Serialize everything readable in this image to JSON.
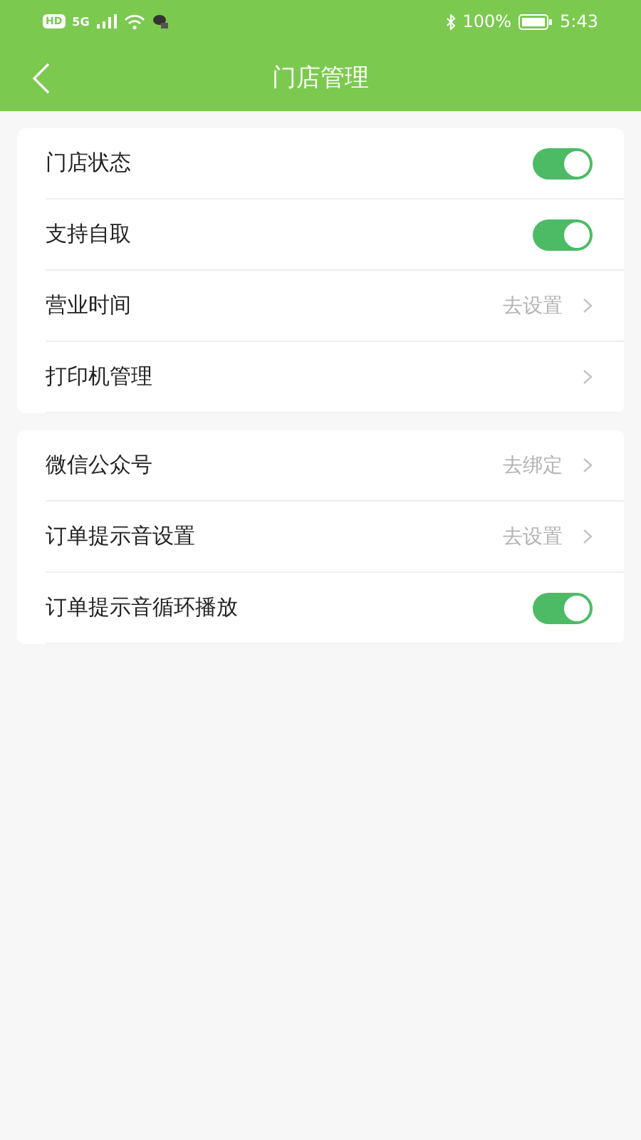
{
  "status_bar": {
    "left": [
      "HD",
      "5G"
    ],
    "battery": "100%",
    "time": "5:43"
  },
  "nav": {
    "title": "门店管理"
  },
  "groups": [
    {
      "items": [
        {
          "kind": "toggle",
          "label": "门店状态",
          "on": true
        },
        {
          "kind": "toggle",
          "label": "支持自取",
          "on": true
        },
        {
          "kind": "link",
          "label": "营业时间",
          "action": "去设置"
        },
        {
          "kind": "link",
          "label": "打印机管理"
        }
      ]
    },
    {
      "items": [
        {
          "kind": "link",
          "label": "微信公众号",
          "action": "去绑定"
        },
        {
          "kind": "link",
          "label": "订单提示音设置",
          "action": "去设置"
        },
        {
          "kind": "toggle",
          "label": "订单提示音循环播放",
          "on": true
        }
      ]
    }
  ]
}
